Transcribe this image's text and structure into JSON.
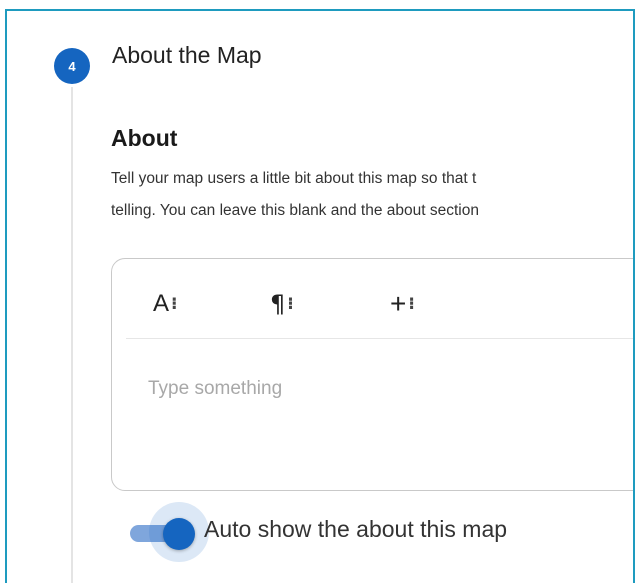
{
  "step": {
    "number": "4",
    "title": "About the Map"
  },
  "about": {
    "heading": "About",
    "description_lines": [
      "Tell your map users a little bit about this map so that t",
      "telling. You can leave this blank and the about section"
    ]
  },
  "editor": {
    "toolbar": {
      "text_style": {
        "label": "A",
        "more": "⁝",
        "icon": "text-style-icon"
      },
      "paragraph": {
        "label": "¶",
        "more": "⁝",
        "icon": "paragraph-icon"
      },
      "insert": {
        "label": "+",
        "more": "⁝",
        "icon": "plus-icon"
      }
    },
    "value": "",
    "placeholder": "Type something"
  },
  "toggle": {
    "label": "Auto show the about this map",
    "checked": true
  },
  "colors": {
    "accent": "#1565c0",
    "frame_border": "#1e9bbf"
  }
}
